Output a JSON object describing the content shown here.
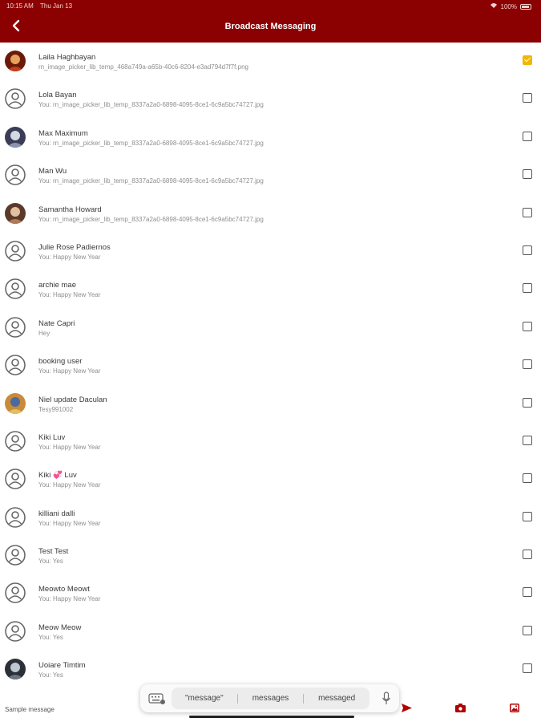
{
  "status_bar": {
    "time": "10:15 AM",
    "date": "Thu Jan 13",
    "battery": "100%"
  },
  "header": {
    "title": "Broadcast Messaging",
    "back_icon": "chevron-left-icon"
  },
  "contacts": [
    {
      "name": "Laila Haghbayan",
      "preview": "rn_image_picker_lib_temp_468a749a-a65b-40c6-8204-e3ad794d7f7f.png",
      "avatar": "photo-red",
      "checked": true
    },
    {
      "name": "Lola Bayan",
      "preview": "You: rn_image_picker_lib_temp_8337a2a0-6898-4095-8ce1-6c9a5bc74727.jpg",
      "avatar": "default",
      "checked": false
    },
    {
      "name": "Max Maximum",
      "preview": "You: rn_image_picker_lib_temp_8337a2a0-6898-4095-8ce1-6c9a5bc74727.jpg",
      "avatar": "photo-grey",
      "checked": false
    },
    {
      "name": "Man Wu",
      "preview": "You: rn_image_picker_lib_temp_8337a2a0-6898-4095-8ce1-6c9a5bc74727.jpg",
      "avatar": "default",
      "checked": false
    },
    {
      "name": "Samantha Howard",
      "preview": "You: rn_image_picker_lib_temp_8337a2a0-6898-4095-8ce1-6c9a5bc74727.jpg",
      "avatar": "photo-tan",
      "checked": false
    },
    {
      "name": "Julie Rose Padiernos",
      "preview": "You: Happy  New Year",
      "avatar": "default",
      "checked": false
    },
    {
      "name": "archie mae",
      "preview": "You: Happy  New Year",
      "avatar": "default",
      "checked": false
    },
    {
      "name": "Nate Capri",
      "preview": "Hey",
      "avatar": "default",
      "checked": false
    },
    {
      "name": "booking user",
      "preview": "You: Happy  New Year",
      "avatar": "default",
      "checked": false
    },
    {
      "name": "Niel update Daculan",
      "preview": "Tesy991002",
      "avatar": "photo-multi",
      "checked": false
    },
    {
      "name": "Kiki Luv",
      "preview": "You: Happy  New Year",
      "avatar": "default",
      "checked": false
    },
    {
      "name": "Kiki 💞 Luv",
      "preview": "You: Happy  New Year",
      "avatar": "default",
      "checked": false
    },
    {
      "name": "killiani dalli",
      "preview": "You: Happy  New Year",
      "avatar": "default",
      "checked": false
    },
    {
      "name": "Test Test",
      "preview": "You: Yes",
      "avatar": "default",
      "checked": false
    },
    {
      "name": "Meowto Meowt",
      "preview": "You: Happy  New Year",
      "avatar": "default",
      "checked": false
    },
    {
      "name": "Meow Meow",
      "preview": "You: Yes",
      "avatar": "default",
      "checked": false
    },
    {
      "name": "Uoiare Timtim",
      "preview": "You: Yes",
      "avatar": "photo-dark",
      "checked": false
    }
  ],
  "composer": {
    "placeholder": "Sample message",
    "send_icon": "send-icon",
    "camera_icon": "camera-icon",
    "gallery_icon": "gallery-icon"
  },
  "keyboard_suggestions": {
    "words": [
      "\"message\"",
      "messages",
      "messaged"
    ],
    "keyboard_icon": "keyboard-icon",
    "mic_icon": "microphone-icon"
  },
  "colors": {
    "header_bg": "#8b0000",
    "checkbox_checked": "#f2b705",
    "accent_icons": "#b00000"
  }
}
